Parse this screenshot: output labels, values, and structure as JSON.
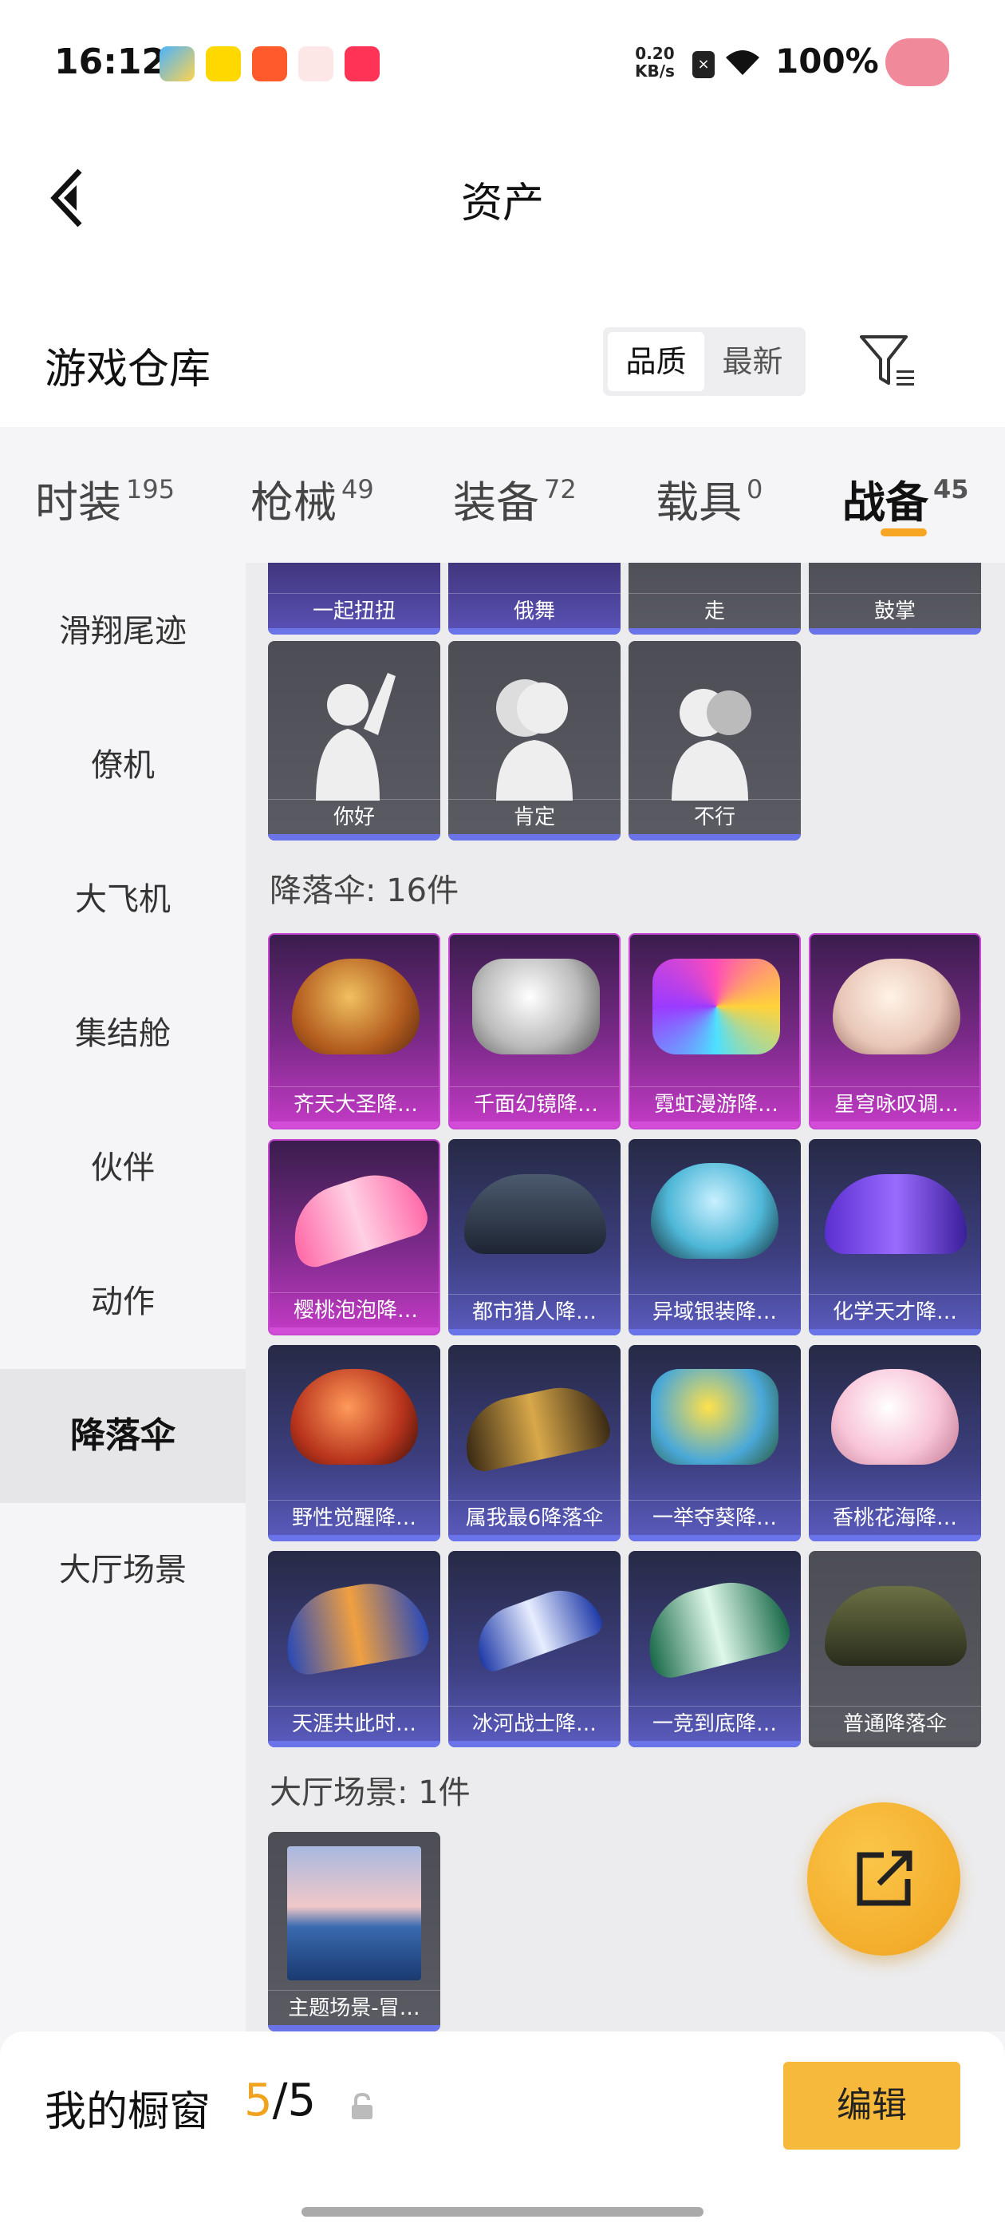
{
  "status_bar": {
    "time": "16:12",
    "net_speed_value": "0.20",
    "net_speed_unit": "KB/s",
    "battery": "100%"
  },
  "header": {
    "title": "资产"
  },
  "warehouse": {
    "title": "游戏仓库",
    "sort_options": [
      "品质",
      "最新"
    ],
    "active_sort": "品质"
  },
  "tabs": [
    {
      "label": "时装",
      "count": "195"
    },
    {
      "label": "枪械",
      "count": "49"
    },
    {
      "label": "装备",
      "count": "72"
    },
    {
      "label": "载具",
      "count": "0"
    },
    {
      "label": "战备",
      "count": "45"
    }
  ],
  "active_tab": "战备",
  "sidebar": {
    "items": [
      "滑翔尾迹",
      "僚机",
      "大飞机",
      "集结舱",
      "伙伴",
      "动作",
      "降落伞",
      "大厅场景"
    ],
    "active": "降落伞"
  },
  "actions_partial": [
    "一起扭扭",
    "俄舞",
    "走",
    "鼓掌"
  ],
  "actions_row": [
    "你好",
    "肯定",
    "不行"
  ],
  "parachute_group": {
    "title": "降落伞: 16件",
    "items": [
      "齐天大圣降…",
      "千面幻镜降…",
      "霓虹漫游降…",
      "星穹咏叹调…",
      "樱桃泡泡降…",
      "都市猎人降…",
      "异域银装降…",
      "化学天才降…",
      "野性觉醒降…",
      "属我最6降落伞",
      "一举夺葵降…",
      "香桃花海降…",
      "天涯共此时…",
      "冰河战士降…",
      "一竞到底降…",
      "普通降落伞"
    ]
  },
  "lobby_group": {
    "title": "大厅场景: 1件",
    "items": [
      "主题场景-冒…"
    ]
  },
  "showcase": {
    "title": "我的橱窗",
    "count_current": "5",
    "count_total": "/5",
    "edit_label": "编辑"
  },
  "colors": {
    "accent": "#f6b93b",
    "legendary": "#c746d2",
    "epic": "#6a73e8"
  }
}
